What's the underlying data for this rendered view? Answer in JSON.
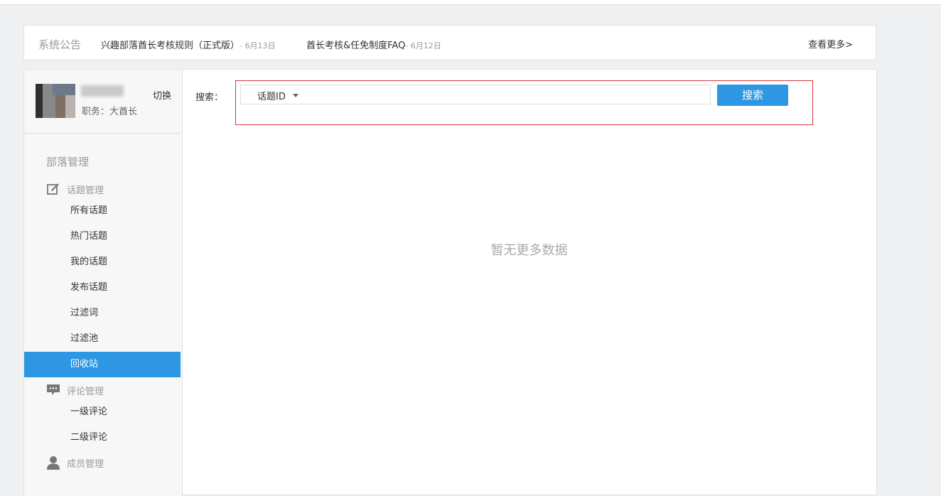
{
  "notice": {
    "label": "系统公告",
    "items": [
      {
        "title": "兴趣部落酋长考核规则（正式版）",
        "date": "- 6月13日"
      },
      {
        "title": "酋长考核&任免制度FAQ",
        "date": "- 6月12日"
      }
    ],
    "more": "查看更多>"
  },
  "profile": {
    "role": "职务：大酋长",
    "switch": "切换"
  },
  "sidebar": {
    "section_title": "部落管理",
    "groups": [
      {
        "label": "话题管理",
        "icon": "edit-icon"
      },
      {
        "label": "评论管理",
        "icon": "comment-icon"
      },
      {
        "label": "成员管理",
        "icon": "user-icon"
      }
    ],
    "items": [
      {
        "label": "所有话题"
      },
      {
        "label": "热门话题"
      },
      {
        "label": "我的话题"
      },
      {
        "label": "发布话题"
      },
      {
        "label": "过滤词"
      },
      {
        "label": "过滤池"
      },
      {
        "label": "回收站"
      },
      {
        "label": "一级评论"
      },
      {
        "label": "二级评论"
      }
    ],
    "active": "回收站"
  },
  "search": {
    "label": "搜索：",
    "type_selected": "话题ID",
    "value": "",
    "button": "搜索"
  },
  "empty_text": "暂无更多数据",
  "colors": {
    "accent": "#2d97e3",
    "highlight_border": "#d9363e",
    "background": "#eef0f2"
  }
}
